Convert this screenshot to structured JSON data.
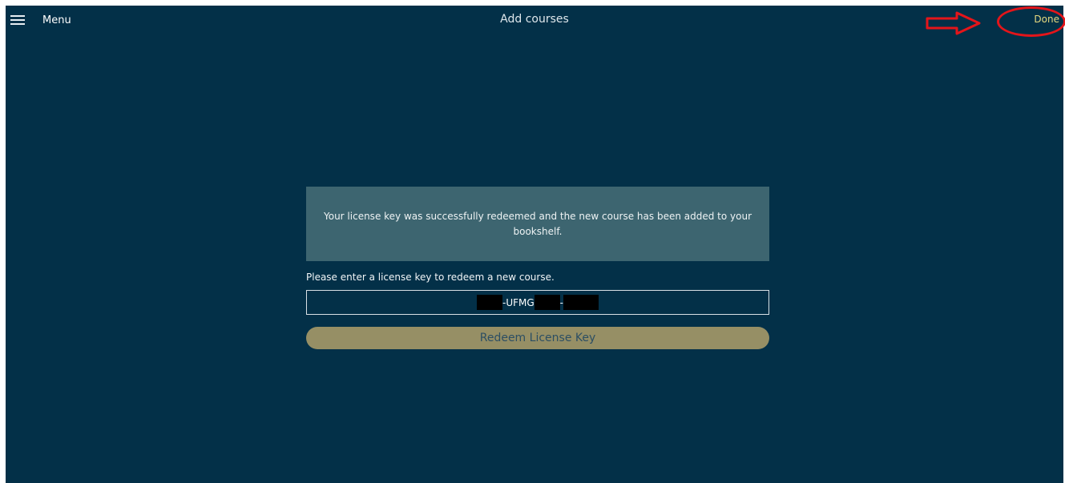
{
  "topbar": {
    "menu_label": "Menu",
    "title": "Add courses",
    "done_label": "Done"
  },
  "notice": {
    "message": "Your license key was successfully redeemed and the new course has been added to your bookshelf."
  },
  "form": {
    "prompt": "Please enter a license key to redeem a new course.",
    "key_segments": [
      "-UFMG",
      "-"
    ],
    "redeem_label": "Redeem License Key"
  },
  "colors": {
    "background": "#033048",
    "notice_bg": "#3d6570",
    "button_bg": "#968f65",
    "done_text": "#e6d97f",
    "annotation": "#e4151a"
  },
  "icons": {
    "menu": "hamburger-icon",
    "annotation_arrow": "right-arrow-icon",
    "annotation_circle": "circle-highlight"
  }
}
